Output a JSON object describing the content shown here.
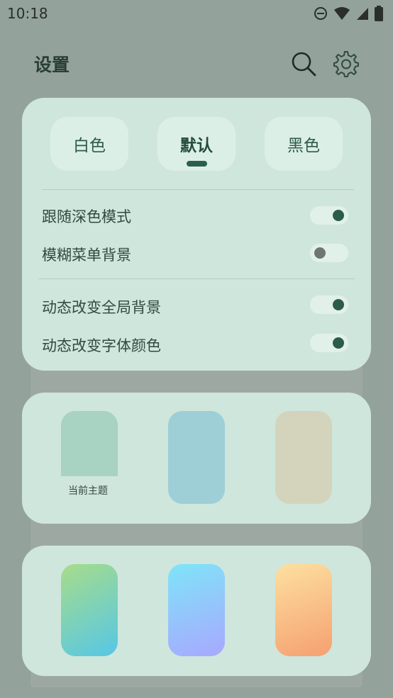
{
  "status_bar": {
    "time": "10:18"
  },
  "header": {
    "title": "设置"
  },
  "theme_buttons": [
    {
      "label": "白色"
    },
    {
      "label": "默认",
      "active": true
    },
    {
      "label": "黑色"
    }
  ],
  "settings": [
    {
      "label": "跟随深色模式",
      "on": true
    },
    {
      "label": "模糊菜单背景",
      "on": false
    },
    {
      "label": "动态改变全局背景",
      "on": true
    },
    {
      "label": "动态改变字体颜色",
      "on": true
    }
  ],
  "solid_themes": {
    "current_label": "当前主题",
    "colors": [
      "#a8d2c2",
      "#9ecfd6",
      "#d4d3bc"
    ]
  },
  "gradient_themes": {
    "colors": [
      [
        "#a8dc8a",
        "#55c7e6"
      ],
      [
        "#7fe4f8",
        "#a8a8ff"
      ],
      [
        "#fde0a0",
        "#f5a070"
      ]
    ]
  },
  "colors": {
    "background": "#93a29a",
    "card": "#cfe6dc",
    "accent": "#2b5c49"
  }
}
